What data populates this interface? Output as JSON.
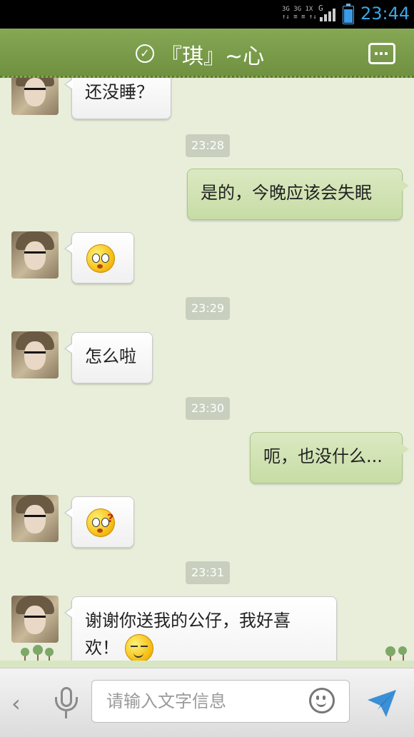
{
  "status_bar": {
    "signal_text_1": "3G 3G 1X",
    "signal_text_2": "↑↓ ≡ ≡ ↑↓",
    "signal_g": "G",
    "time": "23:44",
    "battery_level": 0.78
  },
  "header": {
    "title": "『琪』~心",
    "check_icon": "check-circle-icon",
    "more_icon": "more-options-icon"
  },
  "messages": [
    {
      "type": "in",
      "text": "还没睡？"
    },
    {
      "type": "time",
      "text": "23:28"
    },
    {
      "type": "out",
      "text": "是的，今晚应该会失眠"
    },
    {
      "type": "in",
      "emoji": "surprised-emoji-icon"
    },
    {
      "type": "time",
      "text": "23:29"
    },
    {
      "type": "in",
      "text": "怎么啦"
    },
    {
      "type": "time",
      "text": "23:30"
    },
    {
      "type": "out",
      "text": "呃，也没什么..."
    },
    {
      "type": "in",
      "emoji": "confused-emoji-icon"
    },
    {
      "type": "time",
      "text": "23:31"
    },
    {
      "type": "in",
      "text_line1": "谢谢你送我的公仔，我好喜",
      "text_line2": "欢！",
      "emoji": "shy-emoji-icon"
    }
  ],
  "input_bar": {
    "back_icon": "chevron-left-icon",
    "mic_icon": "microphone-icon",
    "placeholder": "请输入文字信息",
    "emoji_icon": "smiley-icon",
    "send_icon": "send-icon"
  }
}
